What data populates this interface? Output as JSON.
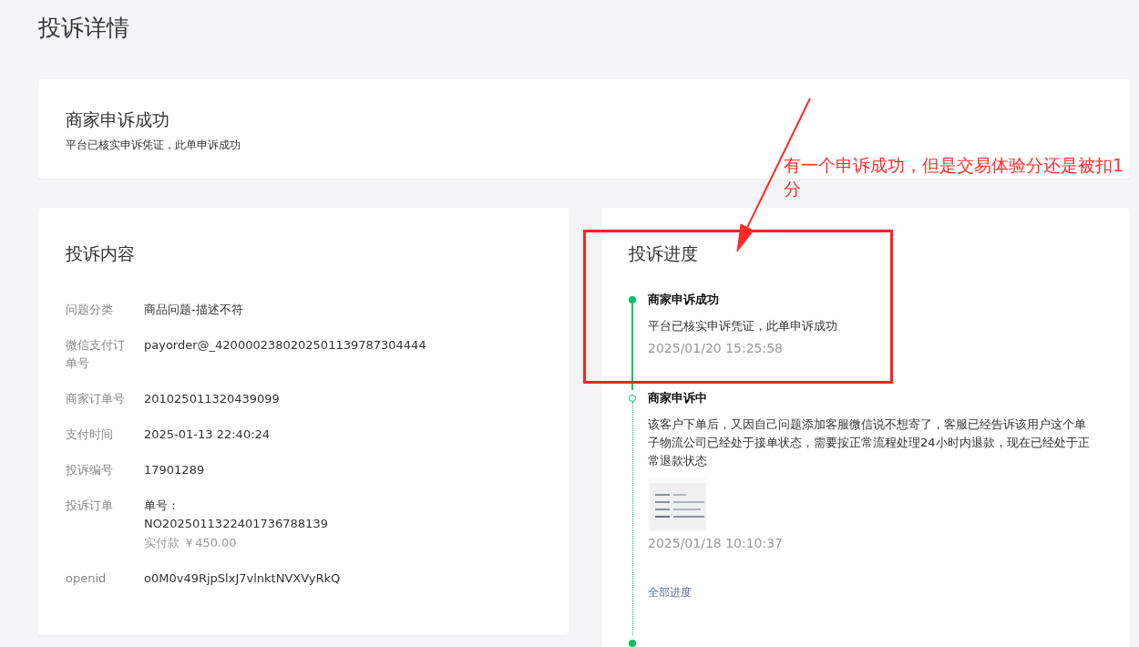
{
  "page_title": "投诉详情",
  "status": {
    "title": "商家申诉成功",
    "subtitle": "平台已核实申诉凭证，此单申诉成功"
  },
  "content": {
    "heading": "投诉内容",
    "fields": [
      {
        "label": "问题分类",
        "lines": [
          "商品问题-描述不符"
        ]
      },
      {
        "label": "微信支付订单号",
        "lines": [
          "payorder@_4200002380202501139787304444"
        ]
      },
      {
        "label": "商家订单号",
        "lines": [
          "201025011320439099"
        ]
      },
      {
        "label": "支付时间",
        "lines": [
          "2025-01-13 22:40:24"
        ]
      },
      {
        "label": "投诉编号",
        "lines": [
          "17901289"
        ]
      },
      {
        "label": "投诉订单",
        "lines": [
          "单号：",
          "NO2025011322401736788139"
        ],
        "note": "实付款 ￥450.00"
      },
      {
        "label": "openid",
        "lines": [
          "o0M0v49RjpSlxJ7vlnktNVXVyRkQ"
        ]
      }
    ]
  },
  "progress": {
    "heading": "投诉进度",
    "items": [
      {
        "kind": "filled",
        "title": "商家申诉成功",
        "text": "平台已核实申诉凭证，此单申诉成功",
        "time": "2025/01/20 15:25:58"
      },
      {
        "kind": "hollow",
        "title": "商家申诉中",
        "text": "该客户下单后，又因自己问题添加客服微信说不想寄了，客服已经告诉该用户这个单子物流公司已经处于接单状态，需要按正常流程处理24小时内退款，现在已经处于正常退款状态",
        "attachment": true,
        "time": "2025/01/18 10:10:37",
        "link": "全部进度"
      },
      {
        "kind": "filled"
      }
    ]
  },
  "annotation": {
    "text": "有一个申诉成功，但是交易体验分还是被扣1分"
  }
}
